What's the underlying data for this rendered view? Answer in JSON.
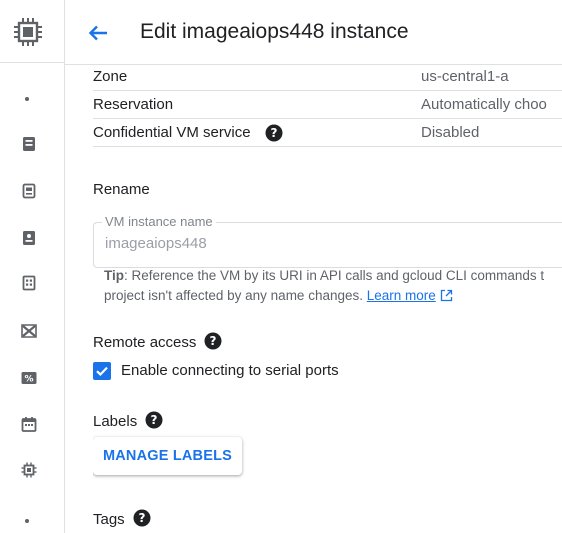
{
  "header": {
    "title": "Edit imageaiops448 instance"
  },
  "details": [
    {
      "key": "Zone",
      "value": "us-central1-a"
    },
    {
      "key": "Reservation",
      "value": "Automatically choo"
    },
    {
      "key": "Confidential VM service",
      "value": "Disabled"
    }
  ],
  "rename": {
    "title": "Rename",
    "field_label": "VM instance name",
    "field_value": "imageaiops448",
    "tip_label": "Tip",
    "tip_text_line1": ": Reference the VM by its URI in API calls and gcloud CLI commands t",
    "tip_text_line2": "project isn't affected by any name changes.",
    "learn_more": "Learn more"
  },
  "remote_access": {
    "title": "Remote access",
    "checkbox_label": "Enable connecting to serial ports",
    "checked": true
  },
  "labels": {
    "title": "Labels",
    "button": "MANAGE LABELS"
  },
  "tags": {
    "title": "Tags"
  },
  "colors": {
    "accent": "#1a73e8",
    "text": "#202124",
    "muted": "#5f6368"
  }
}
